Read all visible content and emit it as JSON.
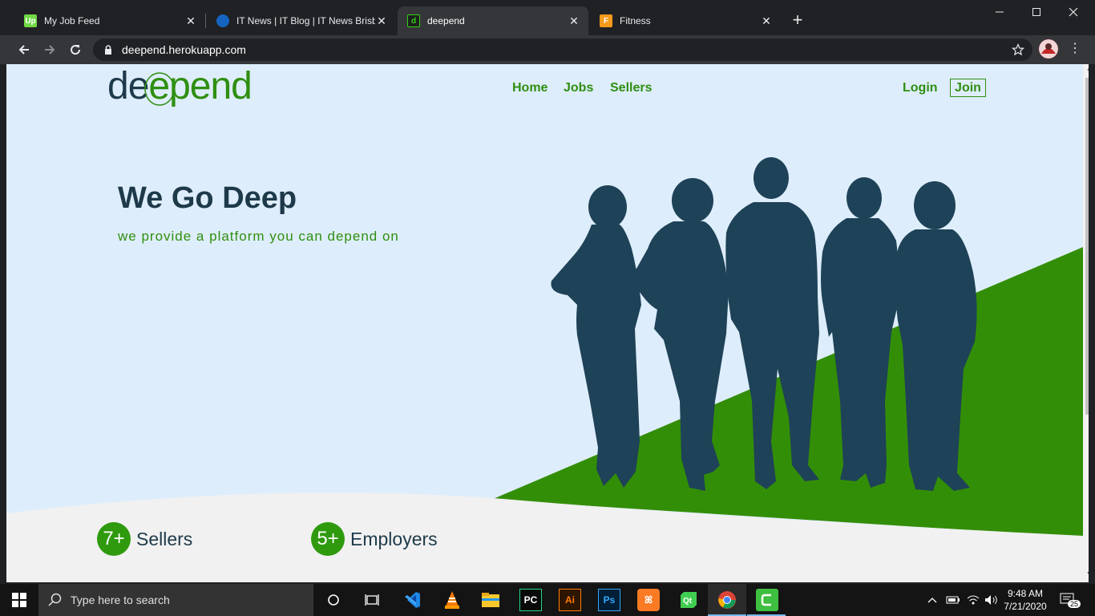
{
  "browser": {
    "tabs": [
      {
        "title": "My Job Feed",
        "favicon": "upwork-icon",
        "favicon_text": "Up",
        "favicon_color": "#6fda44",
        "active": false
      },
      {
        "title": "IT News | IT Blog | IT News Brisbane",
        "favicon": "it-news-icon",
        "favicon_text": "",
        "favicon_color": "#1565c0",
        "active": false
      },
      {
        "title": "deepend",
        "favicon": "deepend-icon",
        "favicon_text": "d",
        "favicon_color": "#2fd60f",
        "active": true
      },
      {
        "title": "Fitness",
        "favicon": "fitness-icon",
        "favicon_text": "F",
        "favicon_color": "#f59a1b",
        "active": false
      }
    ],
    "url": "deepend.herokuapp.com"
  },
  "site": {
    "logo": {
      "part1": "de",
      "part2": "e",
      "part3": "pend"
    },
    "nav": {
      "home": "Home",
      "jobs": "Jobs",
      "sellers": "Sellers",
      "login": "Login",
      "join": "Join"
    },
    "hero": {
      "title": "We Go Deep",
      "subtitle": "we provide a platform you can depend on"
    },
    "stats": [
      {
        "value": "7+",
        "label": "Sellers"
      },
      {
        "value": "5+",
        "label": "Employers"
      }
    ],
    "colors": {
      "primary": "#2f8f10",
      "dark": "#1e3a4a",
      "hero_bg": "#deedfb",
      "footer_bg": "#f0f0f0"
    }
  },
  "taskbar": {
    "search_placeholder": "Type here to search",
    "time": "9:48 AM",
    "date": "7/21/2020",
    "notification_count": "25",
    "apps": [
      "cortana-icon",
      "task-view-icon",
      "vscode-icon",
      "vlc-icon",
      "file-explorer-icon",
      "pycharm-icon",
      "illustrator-icon",
      "photoshop-icon",
      "xampp-icon",
      "qt-icon",
      "chrome-icon",
      "camtasia-icon"
    ]
  }
}
